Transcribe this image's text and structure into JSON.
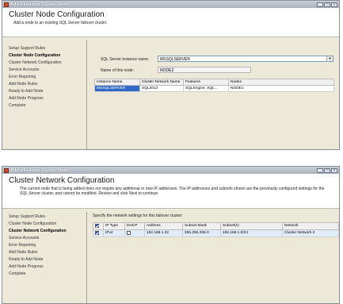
{
  "window1": {
    "title": "Add a Failover Cluster Node",
    "header_title": "Cluster Node Configuration",
    "header_desc": "Add a node to an existing SQL Server failover cluster.",
    "steps": [
      "Setup Support Rules",
      "Cluster Node Configuration",
      "Cluster Network Configuration",
      "Service Accounts",
      "Error Reporting",
      "Add Node Rules",
      "Ready to Add Node",
      "Add Node Progress",
      "Complete"
    ],
    "instance_label": "SQL Server instance name:",
    "instance_value": "MSSQLSERVER",
    "node_label": "Name of this node:",
    "node_value": "NODE2",
    "table": {
      "headers": [
        "Instance Name",
        "Cluster Network Name",
        "Features",
        "Nodes"
      ],
      "rows": [
        [
          "MSSQLSERVER",
          "SQL2012",
          "SQLEngine, SQL...",
          "NODE1"
        ]
      ]
    }
  },
  "window2": {
    "title": "Add a Failover Cluster Node",
    "header_title": "Cluster Network Configuration",
    "header_desc": "The current node that is being added does not require any additional or new IP addresses. The IP addresses and subnets shown are the previously configured settings for the SQL Server cluster, and cannot be modified. Review and click Next to continue.",
    "steps": [
      "Setup Support Rules",
      "Cluster Node Configuration",
      "Cluster Network Configuration",
      "Service Accounts",
      "Error Reporting",
      "Add Node Rules",
      "Ready to Add Node",
      "Add Node Progress",
      "Complete"
    ],
    "prompt": "Specify the network settings for this failover cluster:",
    "table": {
      "headers": [
        "IP Type",
        "DHCP",
        "Address",
        "Subnet Mask",
        "Subnet(s)",
        "Network"
      ],
      "rows": [
        [
          "IPv4",
          "",
          "192.168.1.32",
          "255.255.255.0",
          "192.168.1.0/24",
          "Cluster Network 2"
        ]
      ]
    }
  }
}
